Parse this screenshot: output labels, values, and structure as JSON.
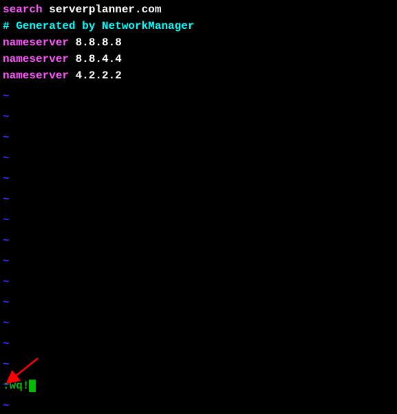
{
  "content": {
    "line1_keyword": "search",
    "line1_value": " serverplanner.com",
    "line2": "# Generated by NetworkManager",
    "line3_keyword": "nameserver",
    "line3_value": " 8.8.8.8",
    "line4_keyword": "nameserver",
    "line4_value": " 8.8.4.4",
    "line5_keyword": "nameserver",
    "line5_value": " 4.2.2.2"
  },
  "empty_line_marker": "~",
  "empty_line_count": 16,
  "command": ":wq!",
  "arrow_color": "#ff0000"
}
